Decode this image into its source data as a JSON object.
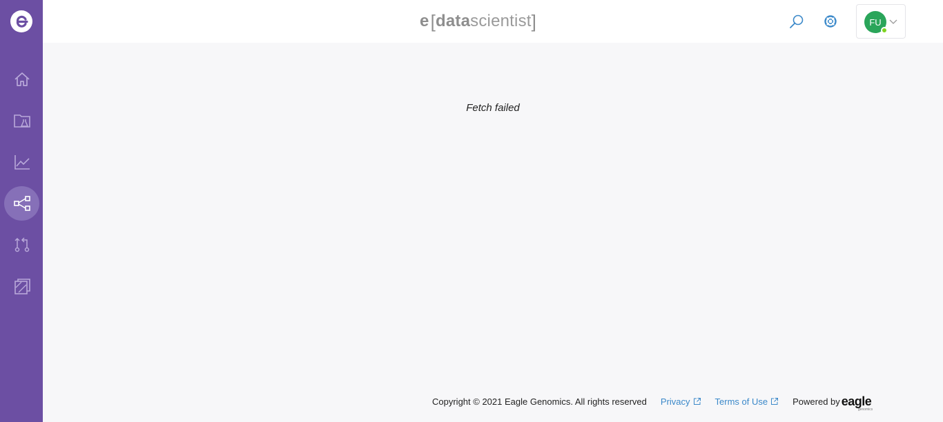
{
  "header": {
    "brand": {
      "e": "e",
      "open_bracket": "[",
      "data": "data",
      "scientist": "scientist",
      "close_bracket": "]"
    },
    "user": {
      "initials": "FU"
    }
  },
  "sidebar": {
    "items": [
      {
        "name": "home",
        "icon": "home-icon",
        "active": false
      },
      {
        "name": "data-assets",
        "icon": "folder-flask-icon",
        "active": false
      },
      {
        "name": "analytics",
        "icon": "line-chart-icon",
        "active": false
      },
      {
        "name": "workflows",
        "icon": "share-nodes-icon",
        "active": true
      },
      {
        "name": "transforms",
        "icon": "compare-arrows-icon",
        "active": false
      },
      {
        "name": "reports",
        "icon": "stacked-docs-icon",
        "active": false
      }
    ]
  },
  "main": {
    "message": "Fetch failed"
  },
  "footer": {
    "copyright": "Copyright © 2021 Eagle Genomics. All rights reserved",
    "privacy": "Privacy",
    "terms": "Terms of Use",
    "powered_by": "Powered by",
    "logo_text": "eagle",
    "logo_subtext": "genomics"
  },
  "colors": {
    "sidebar": "#6c4fa3",
    "sidebar_active": "#8670b8",
    "link": "#3a88c9",
    "avatar": "#2aa55a",
    "status": "#7ed321"
  }
}
